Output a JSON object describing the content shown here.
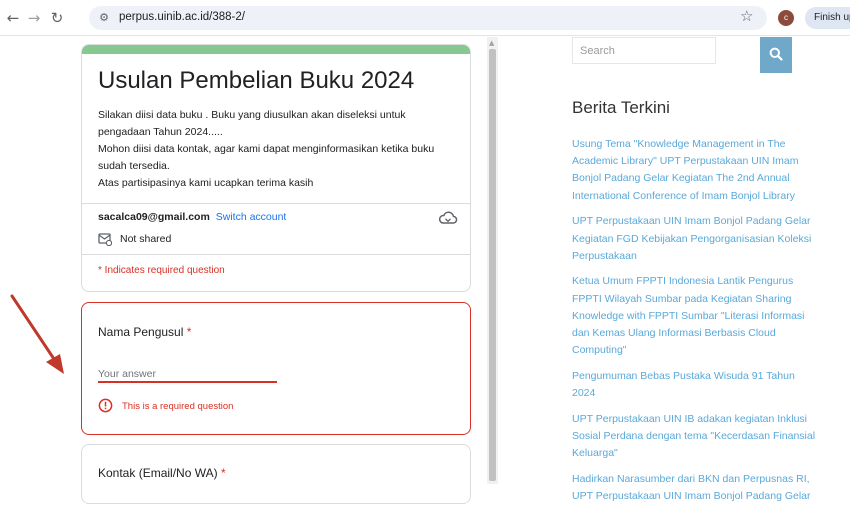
{
  "browser": {
    "url": "perpus.uinib.ac.id/388-2/",
    "profile_initial": "c",
    "finish_update_label": "Finish update"
  },
  "form": {
    "title": "Usulan Pembelian Buku 2024",
    "description": [
      "Silakan diisi data buku . Buku yang diusulkan akan diseleksi untuk pengadaan Tahun 2024.....",
      "Mohon diisi data kontak, agar kami dapat menginformasikan ketika buku sudah tersedia.",
      "Atas partisipasinya kami ucapkan terima kasih"
    ],
    "account_email": "sacalca09@gmail.com",
    "switch_account": "Switch account",
    "not_shared": "Not shared",
    "required_note": "* Indicates required question",
    "questions": [
      {
        "label": "Nama Pengusul",
        "required_mark": "*",
        "placeholder": "Your answer",
        "error": "This is a required question"
      },
      {
        "label": "Kontak (Email/No WA)",
        "required_mark": "*"
      }
    ]
  },
  "sidebar": {
    "search_placeholder": "Search",
    "heading": "Berita Terkini",
    "news": [
      "Usung Tema \"Knowledge Management in The Academic Library\" UPT Perpustakaan UIN Imam Bonjol Padang Gelar Kegiatan The 2nd Annual International Conference of Imam Bonjol Library",
      "UPT Perpustakaan UIN Imam Bonjol Padang Gelar Kegiatan FGD Kebijakan Pengorganisasian Koleksi Perpustakaan",
      "Ketua Umum FPPTI Indonesia Lantik Pengurus FPPTI Wilayah Sumbar pada Kegiatan Sharing Knowledge with FPPTI Sumbar \"Literasi Informasi dan Kemas Ulang Informasi Berbasis Cloud Computing\"",
      "Pengumuman Bebas Pustaka Wisuda 91 Tahun 2024",
      "UPT Perpustakaan UIN IB adakan kegiatan Inklusi Sosial Perdana dengan tema \"Kecerdasan Finansial Keluarga\"",
      "Hadirkan Narasumber dari BKN dan Perpusnas RI, UPT Perpustakaan UIN Imam Bonjol Padang Gelar"
    ]
  },
  "colors": {
    "accent_green": "#86c88f",
    "error_red": "#d93025",
    "link_blue": "#5aa9d9",
    "search_button": "#6fa8c9",
    "annotation_arrow": "#c0392b"
  }
}
